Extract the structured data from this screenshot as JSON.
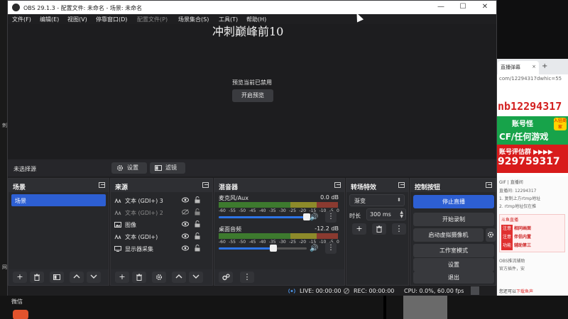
{
  "window": {
    "title": "OBS 29.1.3 - 配置文件: 未命名 - 场景: 未命名",
    "minimize": "—",
    "maximize": "☐",
    "close": "✕"
  },
  "menu": [
    {
      "label": "文件(F)",
      "enabled": true
    },
    {
      "label": "编辑(E)",
      "enabled": true
    },
    {
      "label": "视图(V)",
      "enabled": true
    },
    {
      "label": "停靠窗口(D)",
      "enabled": true
    },
    {
      "label": "配置文件(P)",
      "enabled": false
    },
    {
      "label": "场景集合(S)",
      "enabled": true
    },
    {
      "label": "工具(T)",
      "enabled": true
    },
    {
      "label": "帮助(H)",
      "enabled": true
    }
  ],
  "overlay_title": "冲刺巅峰前10",
  "preview": {
    "disabled_msg": "预览当前已禁用",
    "enable_button": "开启预览"
  },
  "source_toolbar": {
    "no_selection": "未选择源",
    "settings": "设置",
    "filters": "滤镜"
  },
  "scenes": {
    "header": "场景",
    "items": [
      "场景"
    ]
  },
  "sources": {
    "header": "来源",
    "items": [
      {
        "label": "文本 (GDI+) 3",
        "icon": "text-icon",
        "visible": true
      },
      {
        "label": "文本 (GDI+) 2",
        "icon": "text-icon",
        "visible": false
      },
      {
        "label": "图像",
        "icon": "image-icon",
        "visible": true
      },
      {
        "label": "文本 (GDI+)",
        "icon": "text-icon",
        "visible": true
      },
      {
        "label": "显示器采集",
        "icon": "monitor-icon",
        "visible": true
      }
    ]
  },
  "mixer": {
    "header": "混音器",
    "ticks": [
      "-60",
      "-55",
      "-50",
      "-45",
      "-40",
      "-35",
      "-30",
      "-25",
      "-20",
      "-15",
      "-10",
      "-5",
      "0"
    ],
    "tracks": [
      {
        "name": "麦克风/Aux",
        "db": "0.0 dB",
        "volume": 1.0
      },
      {
        "name": "桌面音频",
        "db": "-12.2 dB",
        "volume": 0.62
      }
    ]
  },
  "transitions": {
    "header": "转场特效",
    "selected": "渐变",
    "duration_label": "时长",
    "duration_value": "300 ms"
  },
  "controls": {
    "header": "控制按钮",
    "stop_stream": "停止直播",
    "start_record": "开始录制",
    "virtual_cam": "启动虚拟摄像机",
    "studio_mode": "工作室模式",
    "settings": "设置",
    "exit": "退出"
  },
  "status": {
    "live": "LIVE: 00:00:00",
    "rec": "REC: 00:00:00",
    "cpu": "CPU: 0.0%, 60.00 fps"
  },
  "colors": {
    "accent": "#2d5fd3",
    "window_bg": "#1f1f21",
    "dock_bg": "#27282b"
  },
  "desktop": {
    "taskbar_app": "微信",
    "side_text": [
      "刺",
      "网"
    ]
  },
  "browser": {
    "tab": "直播弹幕",
    "tab_close": "×",
    "tab_plus": "+",
    "url": "com/12294317dwhic=55",
    "ad_title": "nb12294317",
    "ad_logo": "账号怪",
    "ad_badge": "入驻商家",
    "ad_slogan": "CF/任何游戏",
    "ad_group": "账号评估群 ▶▶▶▶",
    "ad_number": "929759317",
    "toolbar": "GIF | 直播间",
    "room_label": "直播间:",
    "room_value": "12294317",
    "line1": "1. 复制上方rtmp地址",
    "line2": "2. rtmp地址仅在推",
    "box_brand": "斗鱼直播",
    "box_items": [
      {
        "tag": "注意",
        "text": "相同画面"
      },
      {
        "tag": "注意",
        "text": "伴侣内置"
      },
      {
        "tag": "功能",
        "text": "辅助第三"
      }
    ],
    "obs_helper": "OBS推流辅助",
    "helper_note": "官方插件，安",
    "footer_a": "您还可以",
    "footer_b": "下载鱼声"
  }
}
